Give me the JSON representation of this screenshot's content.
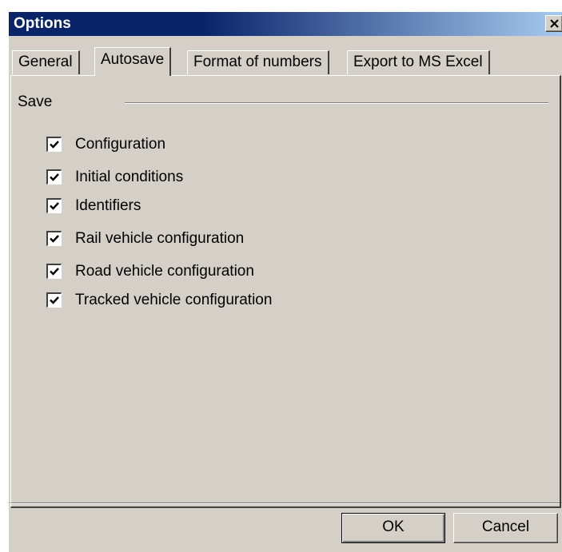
{
  "window": {
    "title": "Options",
    "title_bar_color": "#0a246a"
  },
  "tabs": [
    {
      "label": "General",
      "active": false
    },
    {
      "label": "Autosave",
      "active": true
    },
    {
      "label": "Format of numbers",
      "active": false
    },
    {
      "label": "Export to MS Excel",
      "active": false
    }
  ],
  "autosave": {
    "group_label": "Save",
    "options": [
      {
        "label": "Configuration",
        "checked": true
      },
      {
        "label": "Initial conditions",
        "checked": true
      },
      {
        "label": "Identifiers",
        "checked": true
      },
      {
        "label": "Rail vehicle configuration",
        "checked": true
      },
      {
        "label": "Road vehicle configuration",
        "checked": true
      },
      {
        "label": "Tracked vehicle configuration",
        "checked": true
      }
    ]
  },
  "buttons": {
    "ok_label": "OK",
    "cancel_label": "Cancel"
  },
  "icons": {
    "close": "close-icon",
    "check": "checkmark-icon"
  }
}
